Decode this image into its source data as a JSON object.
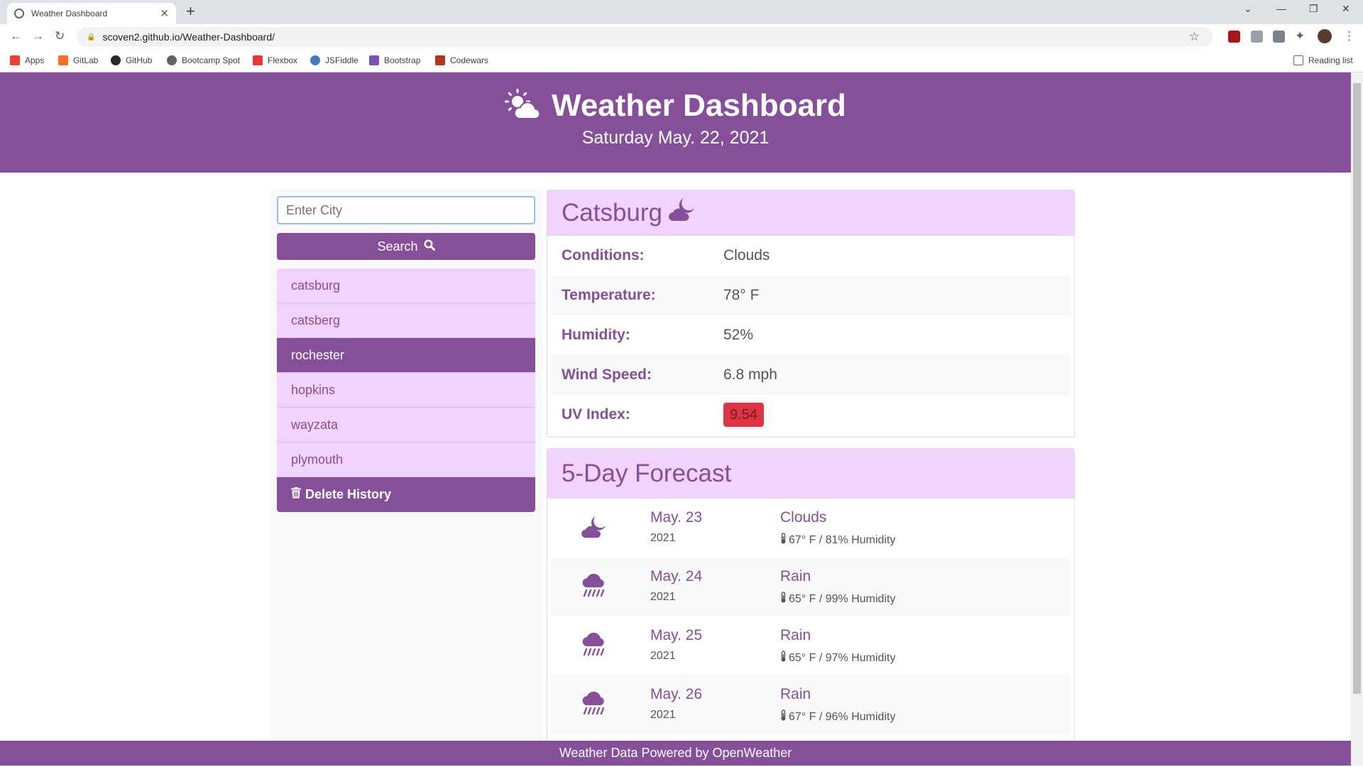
{
  "browser": {
    "tab_title": "Weather Dashboard",
    "url": "scoven2.github.io/Weather-Dashboard/",
    "bookmarks": [
      "Apps",
      "GitLab",
      "GitHub",
      "Bootcamp Spot",
      "Flexbox",
      "JSFiddle",
      "Bootstrap",
      "Codewars"
    ],
    "reading_list": "Reading list"
  },
  "header": {
    "title": "Weather Dashboard",
    "date": "Saturday May. 22, 2021"
  },
  "sidebar": {
    "input_placeholder": "Enter City",
    "search_label": "Search",
    "history": [
      "catsburg",
      "catsberg",
      "rochester",
      "hopkins",
      "wayzata",
      "plymouth"
    ],
    "active_index": 2,
    "delete_label": "Delete History"
  },
  "current": {
    "city": "Catsburg",
    "icon": "cloud-moon-icon",
    "rows": [
      {
        "label": "Conditions:",
        "value": "Clouds"
      },
      {
        "label": "Temperature:",
        "value": "78° F"
      },
      {
        "label": "Humidity:",
        "value": "52%"
      },
      {
        "label": "Wind Speed:",
        "value": "6.8 mph"
      }
    ],
    "uv_label": "UV Index:",
    "uv_value": "9.54"
  },
  "forecast": {
    "title": "5-Day Forecast",
    "days": [
      {
        "date": "May. 23",
        "year": "2021",
        "condition": "Clouds",
        "detail": "67° F / 81% Humidity",
        "icon": "cloud-moon-icon"
      },
      {
        "date": "May. 24",
        "year": "2021",
        "condition": "Rain",
        "detail": "65° F / 99% Humidity",
        "icon": "cloud-rain-icon"
      },
      {
        "date": "May. 25",
        "year": "2021",
        "condition": "Rain",
        "detail": "65° F / 97% Humidity",
        "icon": "cloud-rain-icon"
      },
      {
        "date": "May. 26",
        "year": "2021",
        "condition": "Rain",
        "detail": "67° F / 96% Humidity",
        "icon": "cloud-rain-icon"
      }
    ]
  },
  "footer": {
    "text": "Weather Data Powered by OpenWeather"
  },
  "colors": {
    "brand": "#854f99",
    "light": "#f2d3fe",
    "uv_high": "#dc3545"
  }
}
